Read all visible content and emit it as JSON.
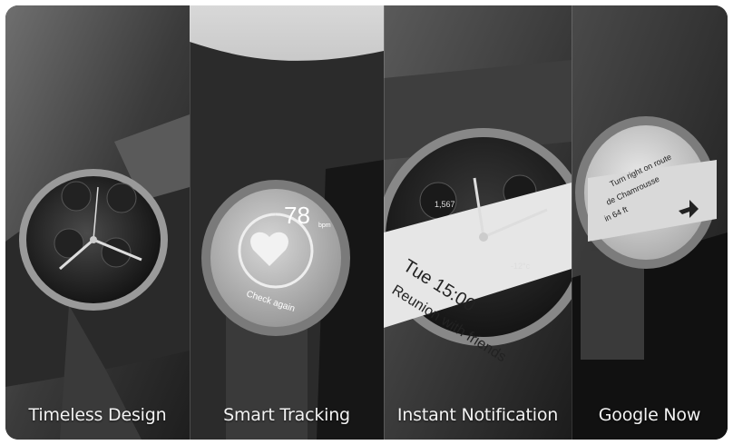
{
  "panels": [
    {
      "caption": "Timeless Design"
    },
    {
      "caption": "Smart Tracking",
      "screen": {
        "value": "78",
        "unit": "bpm",
        "label": "Check again"
      }
    },
    {
      "caption": "Instant Notification",
      "screen": {
        "date": "Tue 15:00",
        "message": "Reunion with friends",
        "steps": "1,567",
        "temp": "-12°c"
      }
    },
    {
      "caption": "Google Now",
      "screen": {
        "text_line1": "Turn right on route",
        "text_line2": "de Chamrousse",
        "text_line3": "in 64 ft"
      }
    }
  ]
}
